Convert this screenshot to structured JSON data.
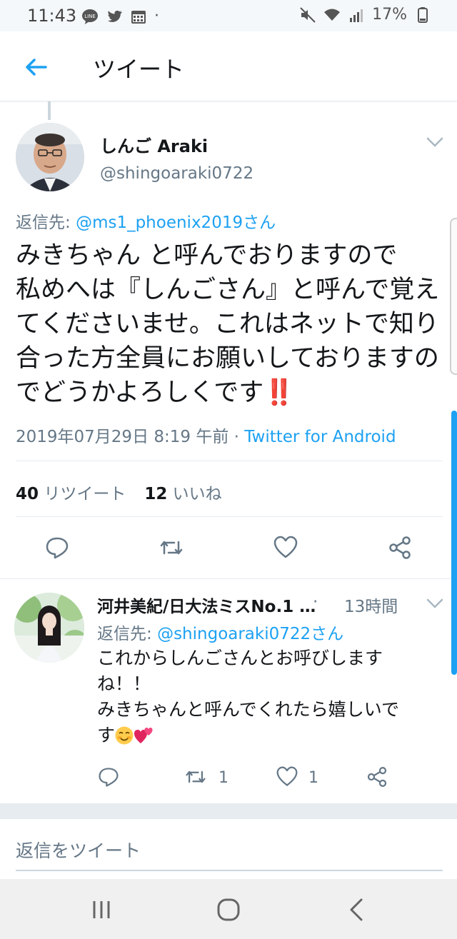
{
  "status_bar": {
    "time": "11:43",
    "battery": "17%",
    "dot": "·",
    "left_icons": [
      "line-icon",
      "twitter-icon",
      "calendar-icon"
    ],
    "right_icons": [
      "mute-icon",
      "wifi-icon",
      "signal-icon",
      "battery-icon"
    ]
  },
  "header": {
    "title": "ツイート",
    "back_icon": "arrow-left-icon"
  },
  "main_tweet": {
    "display_name": "しんご Araki",
    "handle": "@shingoaraki0722",
    "reply_prefix": "返信先: ",
    "reply_mention": "@ms1_phoenix2019さん",
    "text": "みきちゃん と呼んでおりますので\n私めへは『しんごさん』と呼んで覚えてくださいませ。これはネットで知り合った方全員にお願いしておりますのでどうかよろしくです",
    "emoji": "‼️",
    "timestamp": "2019年07月29日 8:19 午前 · ",
    "source": "Twitter for Android",
    "retweet_count": "40",
    "retweet_label": "リツイート",
    "like_count": "12",
    "like_label": "いいね",
    "actions": [
      "reply-icon",
      "retweet-icon",
      "like-icon",
      "share-icon"
    ]
  },
  "reply_tweet": {
    "display_name": "河井美紀/日大法ミスNo.1 …",
    "separator": "·",
    "time": "13時間",
    "reply_prefix": "返信先: ",
    "reply_mention": "@shingoaraki0722さん",
    "text_lines": [
      "これからしんごさんとお呼びします",
      "ね！！",
      "みきちゃんと呼んでくれたら嬉しいで",
      "す"
    ],
    "retweet_count": "1",
    "like_count": "1",
    "actions": [
      "reply-icon",
      "retweet-icon",
      "like-icon",
      "share-icon"
    ]
  },
  "compose": {
    "placeholder": "返信をツイート"
  },
  "nav_bar": {
    "buttons": [
      "recent-apps-icon",
      "home-icon",
      "back-icon"
    ]
  },
  "colors": {
    "accent": "#1da1f2",
    "secondary_text": "#657786",
    "divider": "#e6ecf0",
    "emoji_red": "#d0021b"
  }
}
